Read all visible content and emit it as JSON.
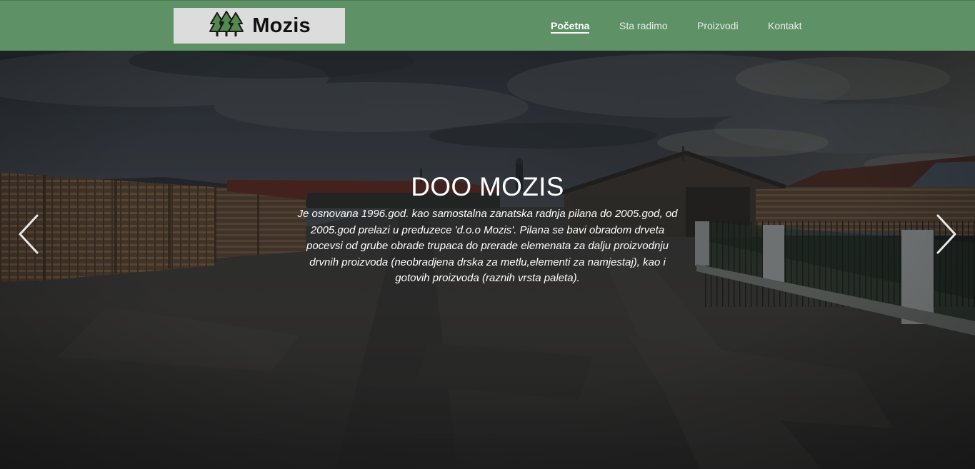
{
  "brand": {
    "name": "Mozis",
    "logo_icon": "pine-trees-icon"
  },
  "nav": {
    "items": [
      {
        "label": "Početna",
        "active": true
      },
      {
        "label": "Sta radimo",
        "active": false
      },
      {
        "label": "Proizvodi",
        "active": false
      },
      {
        "label": "Kontakt",
        "active": false
      }
    ]
  },
  "hero": {
    "title": "DOO MOZIS",
    "description": "Je osnovana 1996.god. kao samostalna zanatska radnja pilana do 2005.god, od 2005.god prelazi u preduzece 'd.o.o Mozis'. Pilana se bavi obradom drveta pocevsi od grube obrade trupaca do prerade elemenata za dalju proizvodnju drvnih proizvoda (neobradjena drska za metlu,elementi za namjestaj), kao i gotovih proizvoda (raznih vrsta paleta).",
    "prev_icon": "chevron-left-icon",
    "next_icon": "chevron-right-icon"
  },
  "colors": {
    "navbar": "#5e9166",
    "brand_box": "#dcdcdc",
    "text": "#ffffff"
  }
}
